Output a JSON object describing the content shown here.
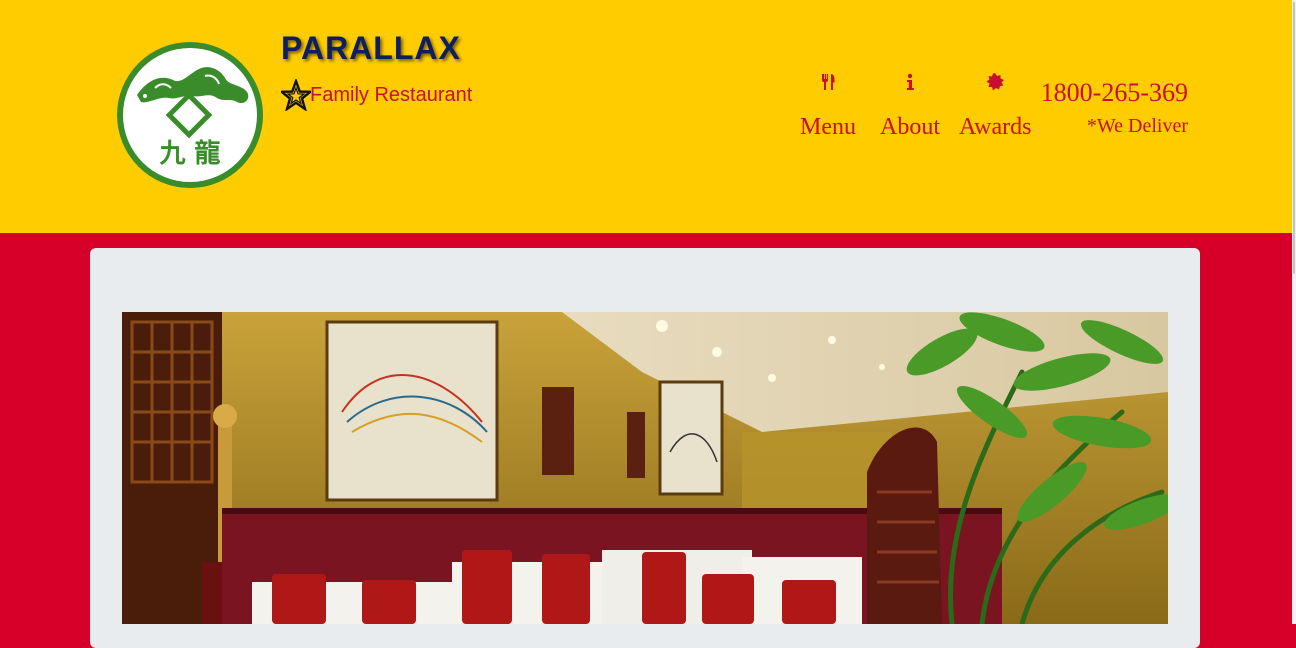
{
  "brand": {
    "title": "PARALLAX",
    "tagline": "Family Restaurant",
    "logo_text": "九 龍"
  },
  "nav": {
    "items": [
      {
        "label": "Menu",
        "icon": "utensils-icon"
      },
      {
        "label": "About",
        "icon": "info-icon"
      },
      {
        "label": "Awards",
        "icon": "certificate-icon"
      }
    ]
  },
  "contact": {
    "phone": "1800-265-369",
    "note": "*We Deliver"
  },
  "colors": {
    "header_bg": "#ffcc00",
    "page_bg": "#d4002a",
    "accent_red": "#c8102e",
    "title_navy": "#0d1f5c",
    "logo_green": "#3a8c2a",
    "panel_bg": "#e9ecef"
  }
}
